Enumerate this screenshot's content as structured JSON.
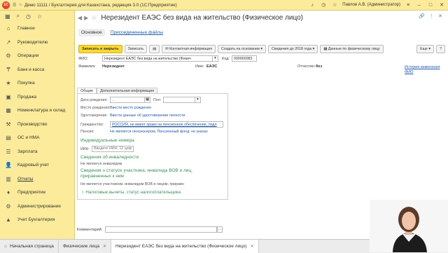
{
  "window": {
    "app_badge": "1С",
    "db": "Демо 11111",
    "title": "Демо 11111 / Бухгалтерия для Казахстана, редакция 3.0 (1С:Предприятие)",
    "user": "Павлов А.В. (Администратор)"
  },
  "sidebar": {
    "items": [
      {
        "label": "Главное",
        "icon": "home-icon"
      },
      {
        "label": "Руководителю",
        "icon": "chart-icon"
      },
      {
        "label": "Операции",
        "icon": "operations-icon"
      },
      {
        "label": "Банк и касса",
        "icon": "bank-icon"
      },
      {
        "label": "Покупка",
        "icon": "cart-icon"
      },
      {
        "label": "Продажа",
        "icon": "sale-icon"
      },
      {
        "label": "Номенклатура и склад",
        "icon": "warehouse-icon"
      },
      {
        "label": "Производство",
        "icon": "factory-icon"
      },
      {
        "label": "ОС и НМА",
        "icon": "assets-icon"
      },
      {
        "label": "Зарплата",
        "icon": "salary-icon"
      },
      {
        "label": "Кадровый учет",
        "icon": "staff-icon"
      },
      {
        "label": "Отчеты",
        "icon": "reports-icon",
        "active": true
      },
      {
        "label": "Предприятие",
        "icon": "enterprise-icon"
      },
      {
        "label": "Администрирование",
        "icon": "admin-icon"
      },
      {
        "label": "Учет Бухгалтерия",
        "icon": "accounting-icon"
      }
    ]
  },
  "form": {
    "title": "Нерезидент ЕАЭС без вида на жительство (Физическое лицо)",
    "tabs": {
      "main": "Основное",
      "files": "Присоединенные файлы"
    },
    "toolbar": {
      "save_close": "Записать и закрыть",
      "save": "Записать",
      "contact": "Контактная информация",
      "create_basis": "Создать на основании",
      "info2018": "Сведения до 2018 года",
      "person_data": "Данные по физическому лицу",
      "more": "Еще",
      "help": "?"
    },
    "fio_label": "ФИО:",
    "fio_value": "Нерезидент ЕАЭС без вида на жительство (Физич",
    "code_label": "Код:",
    "code_value": "000000083",
    "surname_label": "Фамилия:",
    "surname_value": "Нерезидент",
    "name_label": "Имя:",
    "name_value": "ЕАЭС",
    "patronymic_label": "Отчество:",
    "patronymic_value": "без",
    "history_link": "История изменения ФИО",
    "subtabs": {
      "general": "Общие",
      "extra": "Дополнительная информация"
    },
    "birth_label": "Дата рождения:",
    "birth_value": ". .",
    "gender_label": "Пол:",
    "birthplace_label": "Место рождения:",
    "birthplace_value": "Ввести место рождения",
    "id_label": "Удостоверение:",
    "id_value": "Ввести данные об удостоверении личности",
    "citizenship_label": "Гражданство:",
    "citizenship_value": "РОССИЯ, не имеет право на пенсионное обеспечение, подл",
    "pension_label": "Пенсия:",
    "pension_value": "Не является пенсионером, Пенсионный фонд: не указан",
    "individual_numbers": "Индивидуальные номера",
    "iin_label": "ИИН:",
    "iin_placeholder": "Введите ИИН, 12 цифр",
    "disability_section": "Сведения об инвалидности",
    "disability_value": "Не является инвалидом",
    "veteran_section": "Сведения о статусе участника, инвалида ВОВ и лиц, приравненных к ним",
    "veteran_value": "Не является участником, инвалидом ВОВ и лицом, приравн",
    "tax_deductions": "Налоговые вычеты, статус налогоплательщика",
    "comment_label": "Комментарий:"
  },
  "taskbar": {
    "home": "Начальная страница",
    "persons": "Физические лица",
    "current": "Нерезидент ЕАЭС без вида на жительство (Физическое лицо)"
  }
}
